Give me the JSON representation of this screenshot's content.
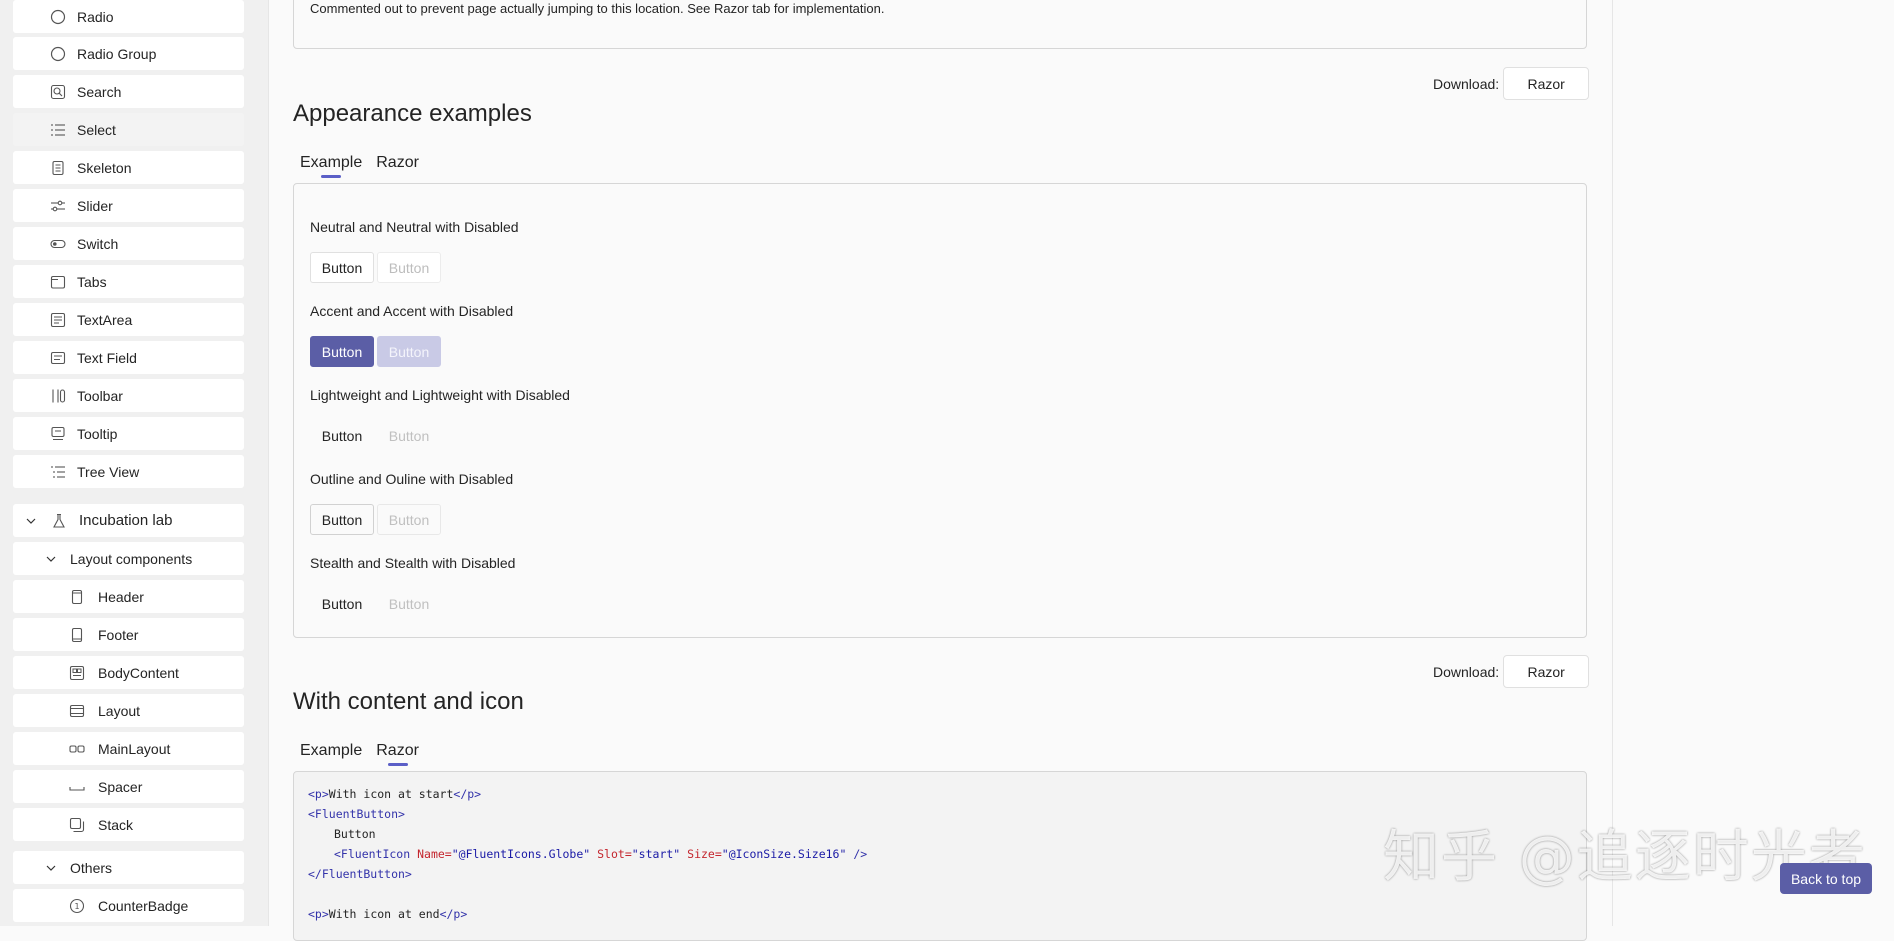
{
  "sidebar": {
    "items": [
      {
        "label": "Radio",
        "icon": "radio-icon"
      },
      {
        "label": "Radio Group",
        "icon": "radio-group-icon"
      },
      {
        "label": "Search",
        "icon": "search-icon"
      },
      {
        "label": "Select",
        "icon": "list-icon"
      },
      {
        "label": "Skeleton",
        "icon": "skeleton-icon"
      },
      {
        "label": "Slider",
        "icon": "slider-icon"
      },
      {
        "label": "Switch",
        "icon": "toggle-icon"
      },
      {
        "label": "Tabs",
        "icon": "tabs-icon"
      },
      {
        "label": "TextArea",
        "icon": "textarea-icon"
      },
      {
        "label": "Text Field",
        "icon": "textfield-icon"
      },
      {
        "label": "Toolbar",
        "icon": "toolbar-icon"
      },
      {
        "label": "Tooltip",
        "icon": "tooltip-icon"
      },
      {
        "label": "Tree View",
        "icon": "tree-icon"
      }
    ],
    "incubation_label": "Incubation lab",
    "layout_components_label": "Layout components",
    "layout_items": [
      {
        "label": "Header",
        "icon": "header-icon"
      },
      {
        "label": "Footer",
        "icon": "footer-icon"
      },
      {
        "label": "BodyContent",
        "icon": "body-content-icon"
      },
      {
        "label": "Layout",
        "icon": "layout-icon"
      },
      {
        "label": "MainLayout",
        "icon": "main-layout-icon"
      },
      {
        "label": "Spacer",
        "icon": "spacer-icon"
      },
      {
        "label": "Stack",
        "icon": "stack-icon"
      }
    ],
    "others_label": "Others",
    "others_items": [
      {
        "label": "CounterBadge",
        "icon": "counter-badge-icon"
      }
    ]
  },
  "top_note": "Commented out to prevent page actually jumping to this location. See Razor tab for implementation.",
  "download": {
    "label": "Download:",
    "button": "Razor"
  },
  "appearance": {
    "title": "Appearance examples",
    "tabs": [
      "Example",
      "Razor"
    ],
    "rows": [
      {
        "label": "Neutral and Neutral with Disabled",
        "button": "Button",
        "disabled_button": "Button"
      },
      {
        "label": "Accent and Accent with Disabled",
        "button": "Button",
        "disabled_button": "Button"
      },
      {
        "label": "Lightweight and Lightweight with Disabled",
        "button": "Button",
        "disabled_button": "Button"
      },
      {
        "label": "Outline and Ouline with Disabled",
        "button": "Button",
        "disabled_button": "Button"
      },
      {
        "label": "Stealth and Stealth with Disabled",
        "button": "Button",
        "disabled_button": "Button"
      }
    ]
  },
  "content_icon": {
    "title": "With content and icon",
    "tabs": [
      "Example",
      "Razor"
    ],
    "code": {
      "l1_open": "<p>",
      "l1_text": "With icon at start",
      "l1_close": "</p>",
      "l2": "<FluentButton>",
      "l3_text": "Button",
      "l4_tag": "<FluentIcon ",
      "l4_attr1": "Name=",
      "l4_val1": "\"@FluentIcons.Globe\"",
      "l4_attr2": " Slot=",
      "l4_val2": "\"start\"",
      "l4_attr3": " Size=",
      "l4_val3": "\"@IconSize.Size16\"",
      "l4_end": " />",
      "l5": "</FluentButton>",
      "l7_open": "<p>",
      "l7_text": "With icon at end",
      "l7_close": "</p>"
    }
  },
  "watermark": "知乎 @追逐时光者",
  "back_to_top": "Back to top",
  "colors": {
    "accent": "#5b5ea6",
    "tab_indicator": "#5b5fc7"
  }
}
